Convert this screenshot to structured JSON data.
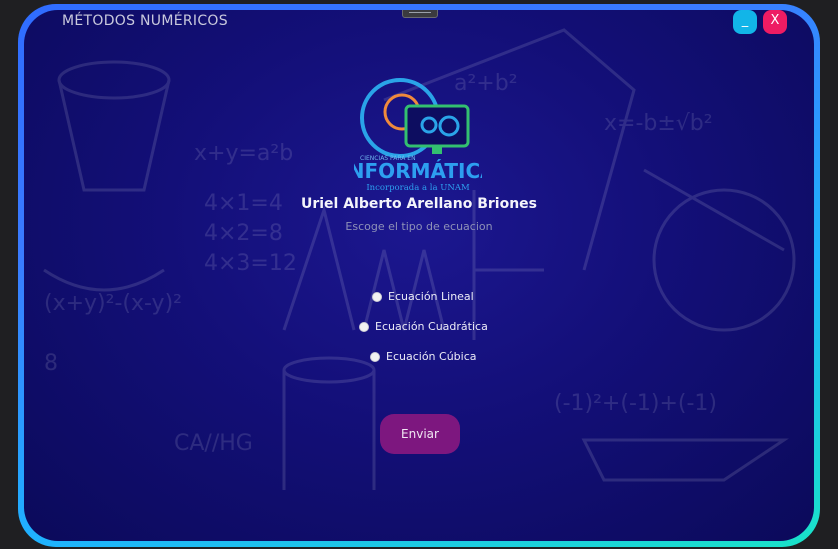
{
  "window": {
    "title": "MÉTODOS NUMÉRICOS",
    "minimize_label": "_",
    "close_label": "X"
  },
  "logo": {
    "top_text": "CIENCIAS PARA EN",
    "main_text": "INFORMÁTICA",
    "sub_text": "Incorporada a la UNAM"
  },
  "header": {
    "name": "Uriel Alberto Arellano Briones",
    "subtitle": "Escoge el tipo de ecuacion"
  },
  "options": [
    {
      "label": "Ecuación Lineal",
      "checked": false
    },
    {
      "label": "Ecuación Cuadrática",
      "checked": false
    },
    {
      "label": "Ecuación Cúbica",
      "checked": false
    }
  ],
  "submit_label": "Enviar",
  "colors": {
    "accent": "#7d177f",
    "minimize": "#12b5e8",
    "close": "#ee1c63",
    "background": "#130f78"
  }
}
